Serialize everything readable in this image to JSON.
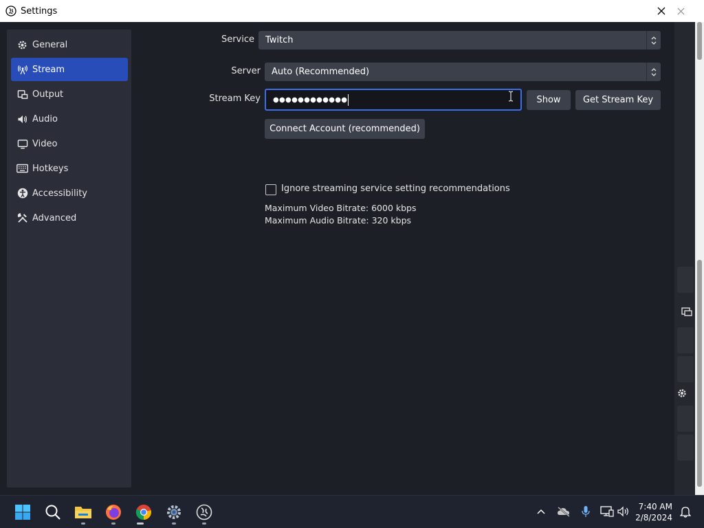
{
  "window": {
    "title": "Settings"
  },
  "sidebar": {
    "items": [
      {
        "label": "General",
        "icon": "gear-icon"
      },
      {
        "label": "Stream",
        "icon": "antenna-icon",
        "active": true
      },
      {
        "label": "Output",
        "icon": "output-icon"
      },
      {
        "label": "Audio",
        "icon": "speaker-icon"
      },
      {
        "label": "Video",
        "icon": "monitor-icon"
      },
      {
        "label": "Hotkeys",
        "icon": "keyboard-icon"
      },
      {
        "label": "Accessibility",
        "icon": "accessibility-icon"
      },
      {
        "label": "Advanced",
        "icon": "tools-icon"
      }
    ]
  },
  "stream": {
    "service_label": "Service",
    "service_value": "Twitch",
    "server_label": "Server",
    "server_value": "Auto (Recommended)",
    "key_label": "Stream Key",
    "key_value": "●●●●●●●●●●●●",
    "show_button": "Show",
    "get_key_button": "Get Stream Key",
    "connect_button": "Connect Account (recommended)",
    "ignore_label": "Ignore streaming service setting recommendations",
    "ignore_checked": false,
    "max_video": "Maximum Video Bitrate: 6000 kbps",
    "max_audio": "Maximum Audio Bitrate: 320 kbps"
  },
  "taskbar": {
    "apps": [
      "windows-start-icon",
      "search-icon",
      "file-explorer-icon",
      "firefox-icon",
      "chrome-icon",
      "settings-icon",
      "obs-icon"
    ],
    "time": "7:40 AM",
    "date": "2/8/2024"
  },
  "colors": {
    "accent": "#284cb8",
    "focus": "#3b6fe8",
    "panel": "#2b2e38",
    "background": "#1d1f26"
  }
}
